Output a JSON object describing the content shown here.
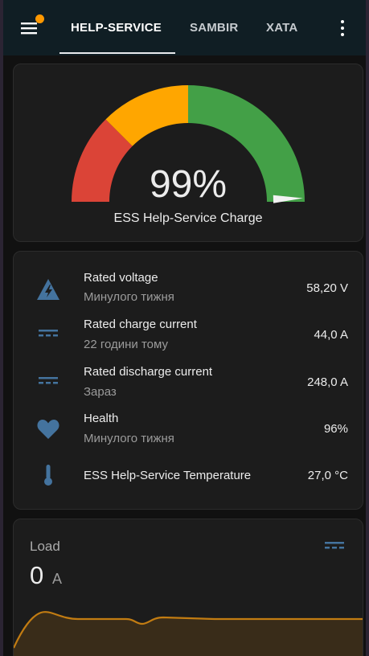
{
  "topbar": {
    "tabs": [
      {
        "label": "HELP-SERVICE"
      },
      {
        "label": "SAMBIR"
      },
      {
        "label": "XATA"
      }
    ]
  },
  "gauge": {
    "value_text": "99%",
    "value": 99,
    "name": "ESS Help-Service Charge",
    "colors": {
      "red": "#db4437",
      "orange": "#ffa600",
      "green": "#43a047"
    }
  },
  "entities": [
    {
      "icon": "flash-triangle-icon",
      "name": "Rated voltage",
      "secondary": "Минулого тижня",
      "value": "58,20 V"
    },
    {
      "icon": "current-dc-icon",
      "name": "Rated charge current",
      "secondary": "22 години тому",
      "value": "44,0 A"
    },
    {
      "icon": "current-dc-icon",
      "name": "Rated discharge current",
      "secondary": "Зараз",
      "value": "248,0 A"
    },
    {
      "icon": "heart-icon",
      "name": "Health",
      "secondary": "Минулого тижня",
      "value": "96%"
    },
    {
      "icon": "thermometer-icon",
      "name": "ESS Help-Service Temperature",
      "secondary": "",
      "value": "27,0 °C"
    }
  ],
  "load": {
    "label": "Load",
    "value": "0",
    "unit": "A",
    "icon": "current-dc-icon",
    "graph_color": "#c27c12"
  },
  "colors": {
    "icon_blue": "#44739e",
    "notification": "#ff9800"
  }
}
